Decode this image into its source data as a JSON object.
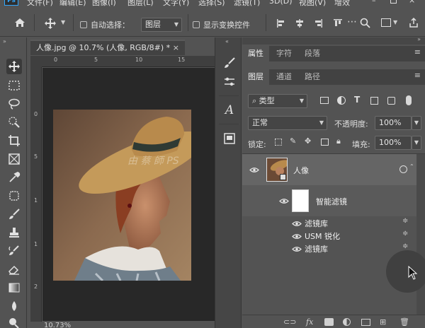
{
  "menubar": {
    "logo": "Ps",
    "items": [
      "文件(F)",
      "编辑(E)",
      "图像(I)",
      "图层(L)",
      "文字(Y)",
      "选择(S)",
      "滤镜(T)",
      "3D(D)",
      "视图(V)",
      "增效"
    ]
  },
  "options": {
    "auto_select_label": "自动选择：",
    "auto_select_target": "图层",
    "show_transform_label": "显示变换控件"
  },
  "document": {
    "tab_title": "人像.jpg @ 10.7% (人像, RGB/8#) *",
    "zoom": "10.73%",
    "ruler_top_ticks": [
      "0",
      "5",
      "10",
      "15"
    ],
    "ruler_left_ticks": [
      "0",
      "5",
      "1",
      "1",
      "2"
    ],
    "watermark": "由 蔡 師 PS"
  },
  "panels": {
    "top_tabs": [
      "属性",
      "字符",
      "段落"
    ],
    "layer_tabs": [
      "图层",
      "通道",
      "路径"
    ],
    "kind_filter": "类型",
    "blend_mode": "正常",
    "opacity_label": "不透明度:",
    "opacity_value": "100%",
    "lock_label": "锁定:",
    "fill_label": "填充:",
    "fill_value": "100%",
    "layer_name": "人像",
    "smart_filter_label": "智能滤镜",
    "filters": [
      "滤镜库",
      "USM 锐化",
      "滤镜库"
    ]
  },
  "colors": {
    "accent": "#31a8ff",
    "panel_bg": "#535353",
    "canvas_bg": "#282828",
    "selected_layer": "#656565"
  }
}
